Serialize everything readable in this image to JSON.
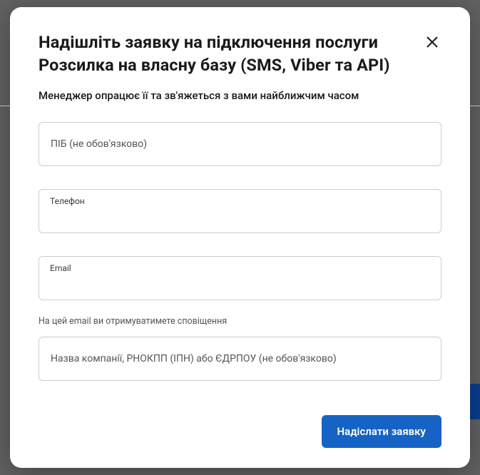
{
  "modal": {
    "title": "Надішліть заявку на підключення послуги Розсилка на власну базу (SMS, Viber та API)",
    "subtitle": "Менеджер опрацює її та зв'яжеться з вами найближчим часом",
    "fields": {
      "name_placeholder": "ПІБ (не обов'язково)",
      "phone_label": "Телефон",
      "email_label": "Email",
      "email_helper": "На цей email ви отримуватимете сповіщення",
      "company_placeholder": "Назва компанії, РНОКПП (ІПН) або ЄДРПОУ (не обов'язково)"
    },
    "submit_label": "Надіслати заявку"
  }
}
